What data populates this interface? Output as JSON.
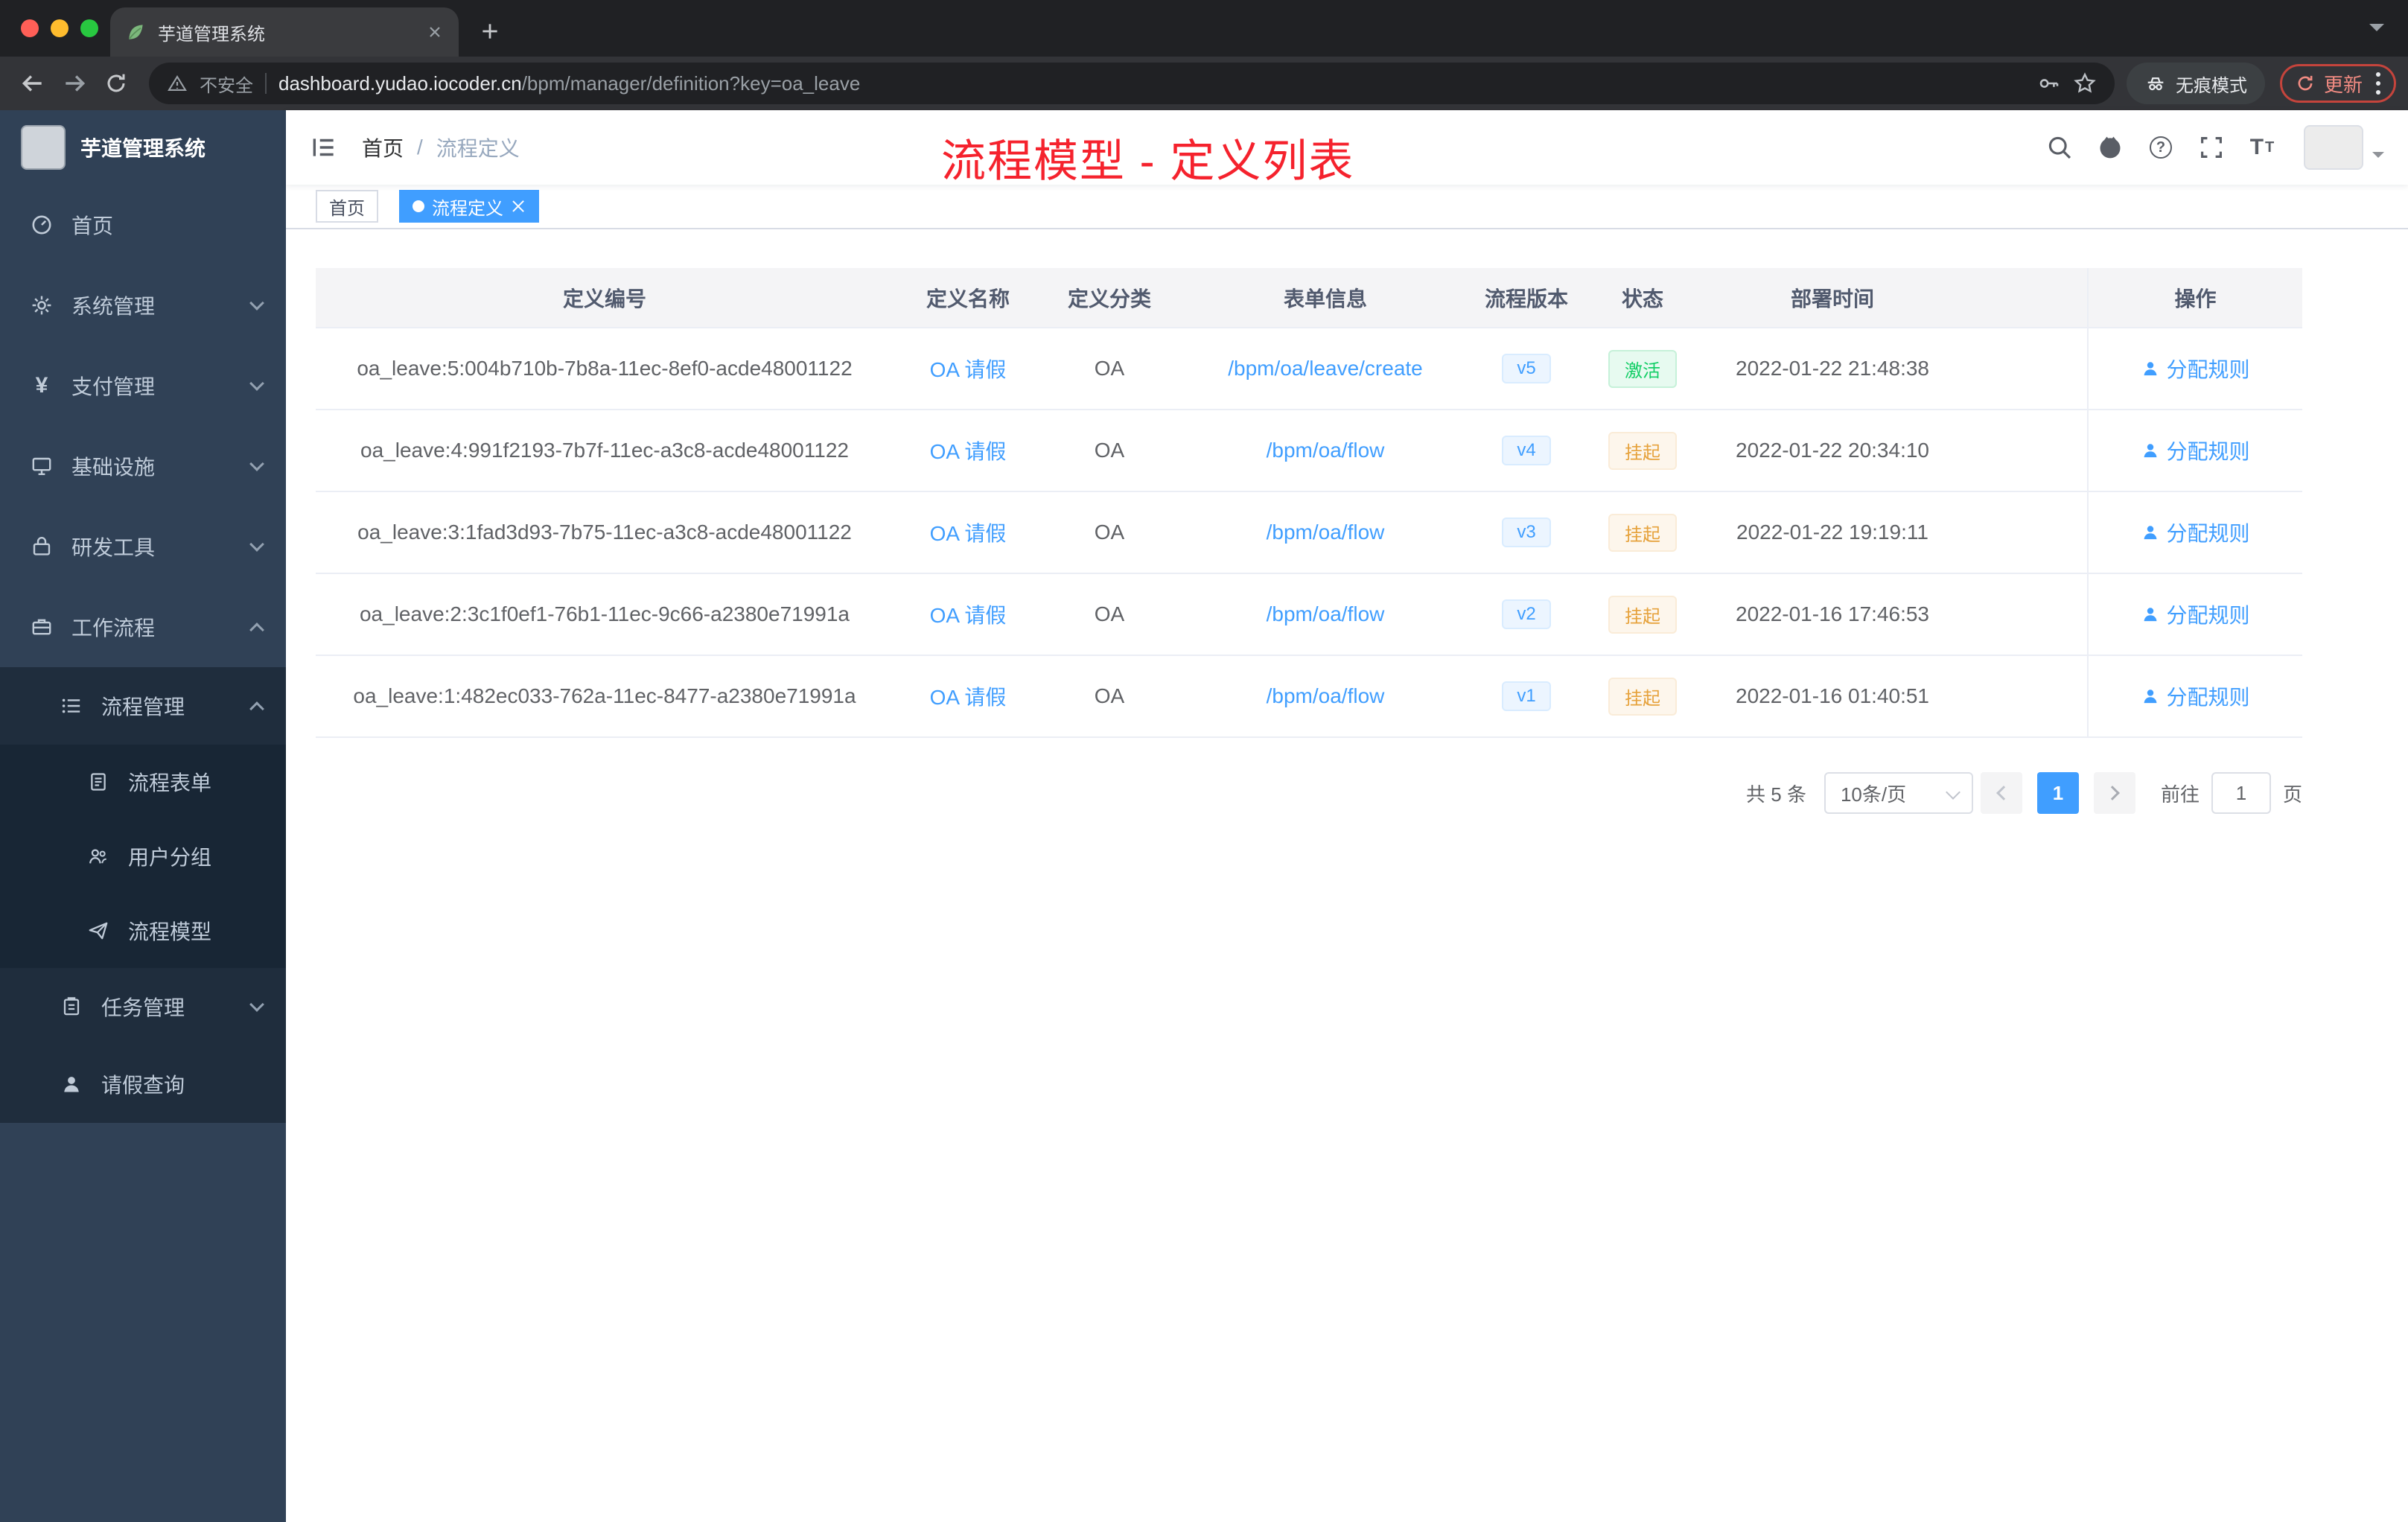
{
  "colors": {
    "accent": "#409eff",
    "annotation_red": "#f5222d",
    "success_green": "#13ce66",
    "warning_orange": "#e6a23c",
    "sidebar_bg": "#304156"
  },
  "browser": {
    "tab_title": "芋道管理系统",
    "security_label": "不安全",
    "url_domain": "dashboard.yudao.iocoder.cn",
    "url_path": "/bpm/manager/definition?key=oa_leave",
    "incognito_label": "无痕模式",
    "update_label": "更新"
  },
  "sidebar": {
    "title": "芋道管理系统",
    "items": [
      {
        "label": "首页",
        "icon": "dashboard-icon"
      },
      {
        "label": "系统管理",
        "icon": "gear-icon"
      },
      {
        "label": "支付管理",
        "icon": "yen-icon"
      },
      {
        "label": "基础设施",
        "icon": "monitor-icon"
      },
      {
        "label": "研发工具",
        "icon": "lock-icon"
      },
      {
        "label": "工作流程",
        "icon": "briefcase-icon"
      },
      {
        "label": "流程管理",
        "icon": "list-icon"
      },
      {
        "label": "流程表单",
        "icon": "form-icon"
      },
      {
        "label": "用户分组",
        "icon": "users-icon"
      },
      {
        "label": "流程模型",
        "icon": "paper-plane-icon"
      },
      {
        "label": "任务管理",
        "icon": "clipboard-icon"
      },
      {
        "label": "请假查询",
        "icon": "user-icon"
      }
    ]
  },
  "header": {
    "breadcrumb": {
      "home": "首页",
      "current": "流程定义"
    },
    "annotation": "流程模型 - 定义列表"
  },
  "tags": {
    "home": "首页",
    "active": "流程定义"
  },
  "table": {
    "columns": {
      "id": "定义编号",
      "name": "定义名称",
      "category": "定义分类",
      "form": "表单信息",
      "version": "流程版本",
      "status": "状态",
      "time": "部署时间",
      "action": "操作"
    },
    "rows": [
      {
        "id": "oa_leave:5:004b710b-7b8a-11ec-8ef0-acde48001122",
        "name": "OA 请假",
        "category": "OA",
        "form": "/bpm/oa/leave/create",
        "version": "v5",
        "status": "激活",
        "time": "2022-01-22 21:48:38",
        "action": "分配规则"
      },
      {
        "id": "oa_leave:4:991f2193-7b7f-11ec-a3c8-acde48001122",
        "name": "OA 请假",
        "category": "OA",
        "form": "/bpm/oa/flow",
        "version": "v4",
        "status": "挂起",
        "time": "2022-01-22 20:34:10",
        "action": "分配规则"
      },
      {
        "id": "oa_leave:3:1fad3d93-7b75-11ec-a3c8-acde48001122",
        "name": "OA 请假",
        "category": "OA",
        "form": "/bpm/oa/flow",
        "version": "v3",
        "status": "挂起",
        "time": "2022-01-22 19:19:11",
        "action": "分配规则"
      },
      {
        "id": "oa_leave:2:3c1f0ef1-76b1-11ec-9c66-a2380e71991a",
        "name": "OA 请假",
        "category": "OA",
        "form": "/bpm/oa/flow",
        "version": "v2",
        "status": "挂起",
        "time": "2022-01-16 17:46:53",
        "action": "分配规则"
      },
      {
        "id": "oa_leave:1:482ec033-762a-11ec-8477-a2380e71991a",
        "name": "OA 请假",
        "category": "OA",
        "form": "/bpm/oa/flow",
        "version": "v1",
        "status": "挂起",
        "time": "2022-01-16 01:40:51",
        "action": "分配规则"
      }
    ]
  },
  "pagination": {
    "total": "共 5 条",
    "page_size": "10条/页",
    "current_page": "1",
    "goto_label": "前往",
    "goto_value": "1",
    "unit_label": "页"
  }
}
